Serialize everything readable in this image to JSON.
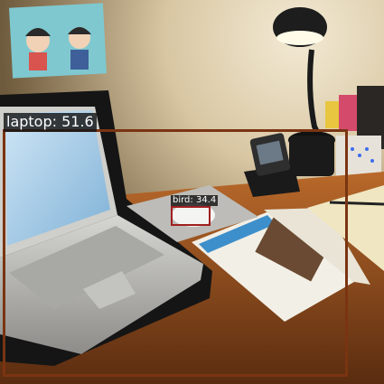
{
  "image": {
    "description_colors": {
      "wall": "#d8c6a2",
      "desk": "#a35a22",
      "lamp_light": "#fffbe8"
    }
  },
  "detections": [
    {
      "label": "laptop: 51.6",
      "class": "laptop",
      "score": 51.6,
      "color": "#7a3412"
    },
    {
      "label": "bird: 34.4",
      "class": "bird",
      "score": 34.4,
      "color": "#a11f1f"
    }
  ]
}
